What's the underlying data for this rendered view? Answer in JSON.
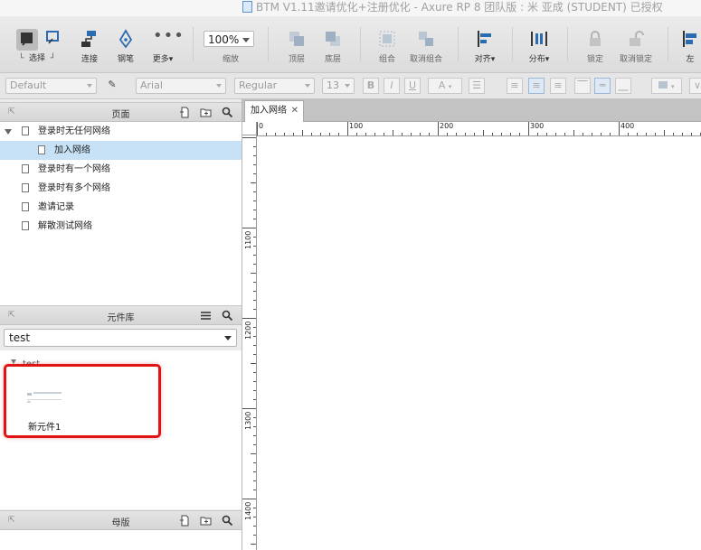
{
  "window": {
    "title": "BTM V1.11邀请优化+注册优化 - Axure RP 8 团队版 : 米 亚成 (STUDENT) 已授权"
  },
  "toolbar": {
    "select": "选择",
    "connect": "连接",
    "pen": "钢笔",
    "more": "更多▾",
    "zoom_value": "100%",
    "zoom_label": "缩放",
    "top": "顶层",
    "bottom": "底层",
    "group": "组合",
    "ungroup": "取消组合",
    "align": "对齐▾",
    "distribute": "分布▾",
    "lock": "锁定",
    "unlock": "取消锁定",
    "left": "左"
  },
  "formatbar": {
    "style": "Default",
    "font": "Arial",
    "weight": "Regular",
    "size": "13",
    "bold": "B",
    "italic": "I",
    "underline": "U",
    "color": "A"
  },
  "pages_panel": {
    "title": "页面",
    "items": [
      {
        "label": "登录时无任何网络"
      },
      {
        "label": "加入网络"
      },
      {
        "label": "登录时有一个网络"
      },
      {
        "label": "登录时有多个网络"
      },
      {
        "label": "邀请记录"
      },
      {
        "label": "解散测试网络"
      }
    ]
  },
  "library_panel": {
    "title": "元件库",
    "selected": "test",
    "group_name": "test",
    "widget_label": "新元件1"
  },
  "masters_panel": {
    "title": "母版"
  },
  "canvas": {
    "tab": "加入网络",
    "tab_close": "✕",
    "h_ruler": [
      "0",
      "100",
      "200",
      "300",
      "400"
    ],
    "v_ruler": [
      "1100",
      "1200",
      "1300",
      "1400"
    ]
  },
  "colors": {
    "highlight": "#e01414",
    "selection": "#c7e2f7"
  }
}
